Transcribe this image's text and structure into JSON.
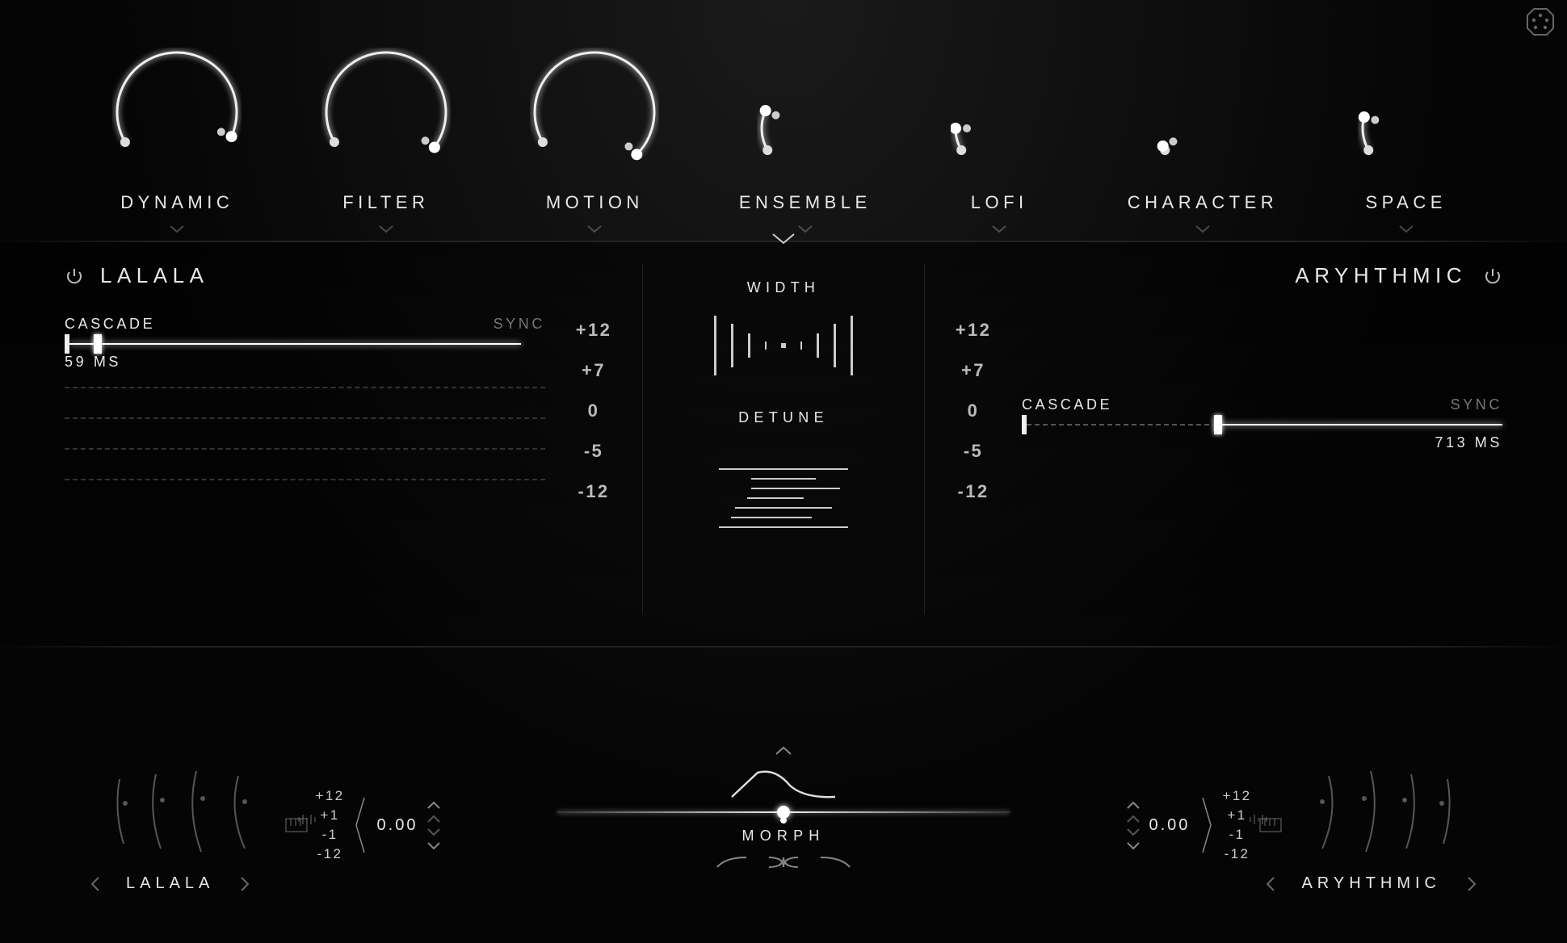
{
  "knobs": [
    {
      "label": "DYNAMIC",
      "value": 0.78
    },
    {
      "label": "FILTER",
      "value": 0.82
    },
    {
      "label": "MOTION",
      "value": 0.85
    },
    {
      "label": "ENSEMBLE",
      "value": 0.18
    },
    {
      "label": "LOFI",
      "value": 0.1
    },
    {
      "label": "CHARACTER",
      "value": 0.02
    },
    {
      "label": "SPACE",
      "value": 0.15
    }
  ],
  "mid": {
    "left": {
      "name": "LALALA",
      "cascade_label": "CASCADE",
      "sync_label": "SYNC",
      "time_label": "59 MS",
      "slider_pos": 0.06
    },
    "right": {
      "name": "ARYHTHMIC",
      "cascade_label": "CASCADE",
      "sync_label": "SYNC",
      "time_label": "713 MS",
      "slider_pos": 0.4
    },
    "scale": [
      "+12",
      "+7",
      "0",
      "-5",
      "-12"
    ],
    "width_label": "WIDTH",
    "detune_label": "DETUNE"
  },
  "bottom": {
    "left": {
      "name": "LALALA",
      "pitch": "0.00",
      "steps": [
        "+12",
        "+1",
        "-1",
        "-12"
      ]
    },
    "right": {
      "name": "ARYHTHMIC",
      "pitch": "0.00",
      "steps": [
        "+12",
        "+1",
        "-1",
        "-12"
      ]
    },
    "morph_label": "MORPH",
    "morph_pos": 0.5
  }
}
